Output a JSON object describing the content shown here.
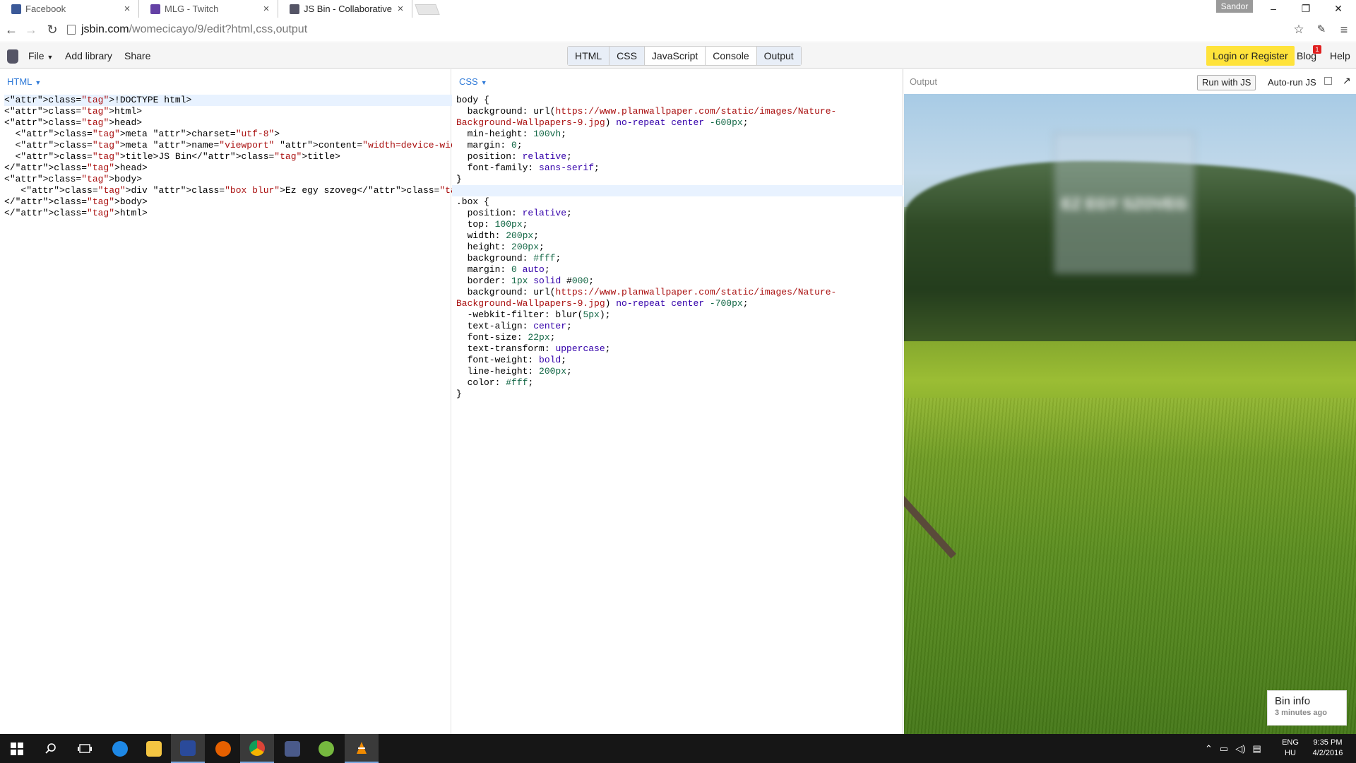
{
  "browser": {
    "tabs": [
      {
        "title": "Facebook",
        "favicon_color": "#3b5998",
        "active": false
      },
      {
        "title": "MLG - Twitch",
        "favicon_color": "#6441a5",
        "active": false
      },
      {
        "title": "JS Bin - Collaborative Java",
        "favicon_color": "#555566",
        "active": true
      }
    ],
    "profile": "Sandor",
    "url_host": "jsbin.com",
    "url_path": "/womecicayo/9/edit?html,css,output"
  },
  "jsbin": {
    "menu": {
      "file": "File",
      "add_library": "Add library",
      "share": "Share"
    },
    "panel_buttons": [
      "HTML",
      "CSS",
      "JavaScript",
      "Console",
      "Output"
    ],
    "login": "Login or Register",
    "blog": "Blog",
    "blog_badge": "1",
    "help": "Help",
    "html_label": "HTML",
    "css_label": "CSS",
    "output_label": "Output",
    "run_button": "Run with JS",
    "autorun": "Auto-run JS",
    "box_text": "Ez egy szoveg",
    "bin_info_title": "Bin info",
    "bin_info_time": "3 minutes ago"
  },
  "html_code": [
    "<!DOCTYPE html>",
    "<html>",
    "<head>",
    "  <meta charset=\"utf-8\">",
    "  <meta name=\"viewport\" content=\"width=device-width\">",
    "  <title>JS Bin</title>",
    "</head>",
    "<body>",
    "   <div class=\"box blur\">Ez egy szoveg</div>",
    "</body>",
    "</html>"
  ],
  "css_code": [
    "body {",
    "  background: url(https://www.planwallpaper.com/static/images/Nature-",
    "Background-Wallpapers-9.jpg) no-repeat center -600px;",
    "  min-height: 100vh;",
    "  margin: 0;",
    "  position: relative;",
    "  font-family: sans-serif;",
    "}",
    "",
    ".box {",
    "  position: relative;",
    "  top: 100px;",
    "  width: 200px;",
    "  height: 200px;",
    "  background: #fff;",
    "  margin: 0 auto;",
    "  border: 1px solid #000;",
    "  background: url(https://www.planwallpaper.com/static/images/Nature-",
    "Background-Wallpapers-9.jpg) no-repeat center -700px;",
    "  -webkit-filter: blur(5px);",
    "  text-align: center;",
    "  font-size: 22px;",
    "  text-transform: uppercase;",
    "  font-weight: bold;",
    "  line-height: 200px;",
    "  color: #fff;",
    "}"
  ],
  "taskbar": {
    "lang_top": "ENG",
    "lang_bottom": "HU",
    "time": "9:35 PM",
    "date": "4/2/2016"
  }
}
